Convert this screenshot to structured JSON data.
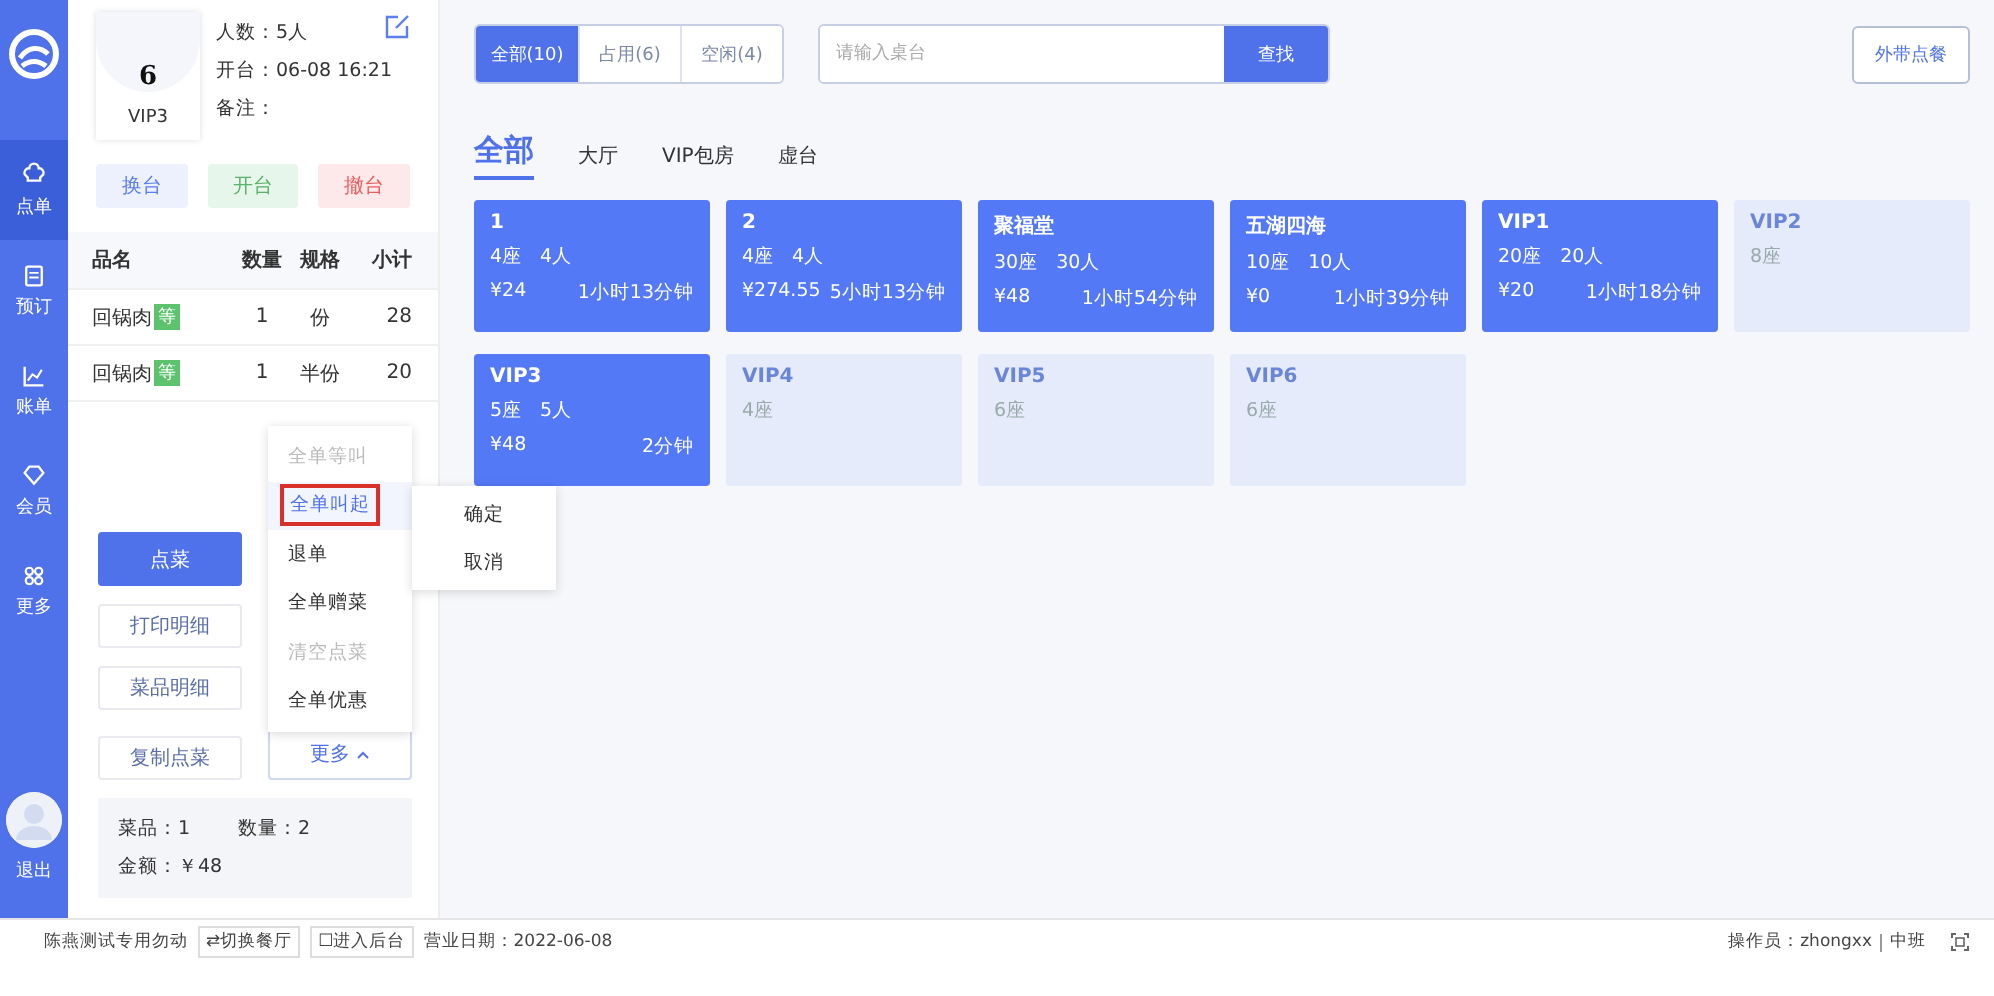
{
  "nav": {
    "items": [
      {
        "label": "点单",
        "selected": true
      },
      {
        "label": "预订",
        "selected": false
      },
      {
        "label": "账单",
        "selected": false
      },
      {
        "label": "会员",
        "selected": false
      },
      {
        "label": "更多",
        "selected": false
      }
    ],
    "logout": "退出"
  },
  "table_info": {
    "number": "6",
    "name": "VIP3",
    "guests": "人数：5人",
    "opened": "开台：06-08 16:21",
    "note": "备注："
  },
  "table_actions": [
    {
      "label": "换台",
      "kind": "blue"
    },
    {
      "label": "开台",
      "kind": "green"
    },
    {
      "label": "撤台",
      "kind": "red"
    }
  ],
  "order": {
    "columns": [
      "品名",
      "数量",
      "规格",
      "小计"
    ],
    "rows": [
      {
        "name": "回锅肉",
        "tag": "等",
        "qty": "1",
        "spec": "份",
        "subtotal": "28"
      },
      {
        "name": "回锅肉",
        "tag": "等",
        "qty": "1",
        "spec": "半份",
        "subtotal": "20"
      }
    ]
  },
  "order_buttons": [
    "点菜",
    "打印明细",
    "菜品明细",
    "复制点菜"
  ],
  "more_button": {
    "label": "更多",
    "expanded": true
  },
  "more_menu": [
    {
      "label": "全单等叫",
      "disabled": true,
      "selected": false
    },
    {
      "label": "全单叫起",
      "disabled": false,
      "selected": true
    },
    {
      "label": "退单",
      "disabled": false,
      "selected": false
    },
    {
      "label": "全单赠菜",
      "disabled": false,
      "selected": false
    },
    {
      "label": "清空点菜",
      "disabled": true,
      "selected": false
    },
    {
      "label": "全单优惠",
      "disabled": false,
      "selected": false
    }
  ],
  "confirm_menu": [
    "确定",
    "取消"
  ],
  "summary": {
    "items": "菜品：1",
    "quantity": "数量：2",
    "amount": "金额：￥48"
  },
  "filters": [
    {
      "label": "全部(10)",
      "selected": true
    },
    {
      "label": "占用(6)",
      "selected": false
    },
    {
      "label": "空闲(4)",
      "selected": false
    }
  ],
  "search": {
    "placeholder": "请输入桌台",
    "button": "查找"
  },
  "takeout_button": "外带点餐",
  "areas": [
    {
      "label": "全部",
      "selected": true
    },
    {
      "label": "大厅",
      "selected": false
    },
    {
      "label": "VIP包房",
      "selected": false
    },
    {
      "label": "虚台",
      "selected": false
    }
  ],
  "tables": [
    {
      "name": "1",
      "occupied": true,
      "seats": "4座",
      "guests": "4人",
      "amount": "¥24",
      "duration": "1小时13分钟"
    },
    {
      "name": "2",
      "occupied": true,
      "seats": "4座",
      "guests": "4人",
      "amount": "¥274.55",
      "duration": "5小时13分钟"
    },
    {
      "name": "聚福堂",
      "occupied": true,
      "seats": "30座",
      "guests": "30人",
      "amount": "¥48",
      "duration": "1小时54分钟"
    },
    {
      "name": "五湖四海",
      "occupied": true,
      "seats": "10座",
      "guests": "10人",
      "amount": "¥0",
      "duration": "1小时39分钟"
    },
    {
      "name": "VIP1",
      "occupied": true,
      "seats": "20座",
      "guests": "20人",
      "amount": "¥20",
      "duration": "1小时18分钟"
    },
    {
      "name": "VIP2",
      "occupied": false,
      "seats": "8座"
    },
    {
      "name": "VIP3",
      "occupied": true,
      "seats": "5座",
      "guests": "5人",
      "amount": "¥48",
      "duration": "2分钟"
    },
    {
      "name": "VIP4",
      "occupied": false,
      "seats": "4座"
    },
    {
      "name": "VIP5",
      "occupied": false,
      "seats": "6座"
    },
    {
      "name": "VIP6",
      "occupied": false,
      "seats": "6座"
    }
  ],
  "status_bar": {
    "restaurant": "陈燕测试专用勿动",
    "switch_button": "⇄切换餐厅",
    "backend_button": "☐进入后台",
    "business_date": "营业日期：2022-06-08",
    "operator": "操作员：zhongxx",
    "shift": "中班"
  }
}
